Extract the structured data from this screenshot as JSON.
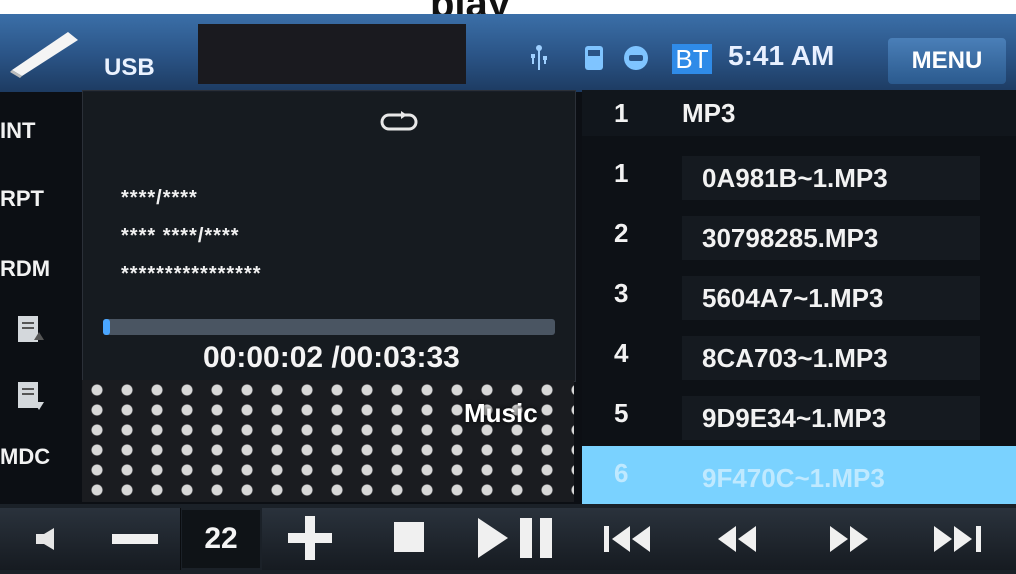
{
  "caption": {
    "text": "play"
  },
  "statusbar": {
    "source_label": "USB",
    "bt_label": "BT",
    "clock": "5:41 AM",
    "menu_label": "MENU"
  },
  "side_buttons": {
    "int": "INT",
    "rpt": "RPT",
    "rdm": "RDM",
    "mdc": "MDC"
  },
  "track_info": {
    "line1": "****/****",
    "line2": "**** ****/****",
    "line3": "****************",
    "progress": 0.01,
    "timecode": "00:00:02 /00:03:33",
    "category": "Music"
  },
  "playlist": {
    "header": {
      "num": "1",
      "label": "MP3"
    },
    "items": [
      {
        "num": "1",
        "name": "0A981B~1.MP3"
      },
      {
        "num": "2",
        "name": "30798285.MP3"
      },
      {
        "num": "3",
        "name": "5604A7~1.MP3"
      },
      {
        "num": "4",
        "name": "8CA703~1.MP3"
      },
      {
        "num": "5",
        "name": "9D9E34~1.MP3"
      },
      {
        "num": "6",
        "name": "9F470C~1.MP3",
        "selected": true
      }
    ]
  },
  "controls": {
    "volume": "22",
    "icons": [
      "mute-icon",
      "volume-down-icon",
      "volume-up-icon",
      "stop-icon",
      "play-pause-icon",
      "previous-track-icon",
      "rewind-icon",
      "fast-forward-icon",
      "next-track-icon"
    ]
  },
  "colors": {
    "accent": "#4aa6ff",
    "selected_row": "#7ad2ff",
    "statusbar": "#2a5385"
  }
}
